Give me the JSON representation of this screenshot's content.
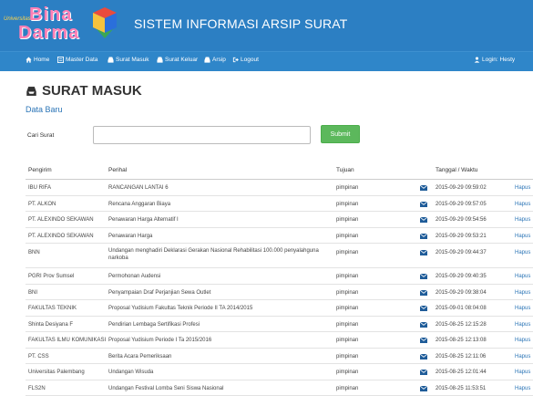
{
  "header": {
    "logo_small": "Universitas",
    "logo_line1": "Bina",
    "logo_line2": "Darma",
    "title": "SISTEM INFORMASI ARSIP SURAT"
  },
  "nav": {
    "home": "Home",
    "master_data": "Master Data",
    "surat_masuk": "Surat Masuk",
    "surat_keluar": "Surat Keluar",
    "arsip": "Arsip",
    "logout": "Logout",
    "login_user": "Login: Hesty"
  },
  "page": {
    "title": "SURAT MASUK",
    "new_link": "Data Baru",
    "search_label": "Cari Surat",
    "search_value": "",
    "submit_label": "Submit"
  },
  "table": {
    "headers": {
      "pengirim": "Pengirim",
      "perihal": "Perihal",
      "tujuan": "Tujuan",
      "tanggal": "Tanggal / Waktu"
    },
    "delete_label": "Hapus",
    "rows": [
      {
        "pengirim": "IBU RIFA",
        "perihal": "RANCANGAN LANTAI 6",
        "tujuan": "pimpinan",
        "tanggal": "2015-09-29 09:59:02"
      },
      {
        "pengirim": "PT. ALKON",
        "perihal": "Rencana Anggaran Biaya",
        "tujuan": "pimpinan",
        "tanggal": "2015-09-29 09:57:05"
      },
      {
        "pengirim": "PT. ALEXINDO SEKAWAN",
        "perihal": "Penawaran Harga Alternatif I",
        "tujuan": "pimpinan",
        "tanggal": "2015-09-29 09:54:56"
      },
      {
        "pengirim": "PT. ALEXINDO SEKAWAN",
        "perihal": "Penawaran Harga",
        "tujuan": "pimpinan",
        "tanggal": "2015-09-29 09:53:21"
      },
      {
        "pengirim": "BNN",
        "perihal": "Undangan menghadiri Deklarasi Gerakan Nasional Rehabilitasi 100.000 penyalahguna narkoba",
        "tujuan": "pimpinan",
        "tanggal": "2015-09-29 09:44:37"
      },
      {
        "pengirim": "PGRI Prov Sumsel",
        "perihal": "Permohonan Audensi",
        "tujuan": "pimpinan",
        "tanggal": "2015-09-29 09:40:35"
      },
      {
        "pengirim": "BNI",
        "perihal": "Penyampaian Draf Perjanjian Sewa Outlet",
        "tujuan": "pimpinan",
        "tanggal": "2015-09-29 09:38:04"
      },
      {
        "pengirim": "FAKULTAS TEKNIK",
        "perihal": "Proposal Yudisium Fakultas Teknik Periode II TA 2014/2015",
        "tujuan": "pimpinan",
        "tanggal": "2015-09-01 08:04:08"
      },
      {
        "pengirim": "Shinta Desiyana F",
        "perihal": "Pendirian Lembaga Sertifikasi Profesi",
        "tujuan": "pimpinan",
        "tanggal": "2015-08-25 12:15:28"
      },
      {
        "pengirim": "FAKULTAS ILMU KOMUNIKASI",
        "perihal": "Proposal Yudisium Periode I Ta 2015/2016",
        "tujuan": "pimpinan",
        "tanggal": "2015-08-25 12:13:08"
      },
      {
        "pengirim": "PT. CSS",
        "perihal": "Berita Acara Pemeriksaan",
        "tujuan": "pimpinan",
        "tanggal": "2015-08-25 12:11:06"
      },
      {
        "pengirim": "Universitas Palembang",
        "perihal": "Undangan Wisuda",
        "tujuan": "pimpinan",
        "tanggal": "2015-08-25 12:01:44"
      },
      {
        "pengirim": "FLS2N",
        "perihal": "Undangan Festival Lomba Seni Siswa Nasional",
        "tujuan": "pimpinan",
        "tanggal": "2015-08-25 11:53:51"
      }
    ]
  }
}
